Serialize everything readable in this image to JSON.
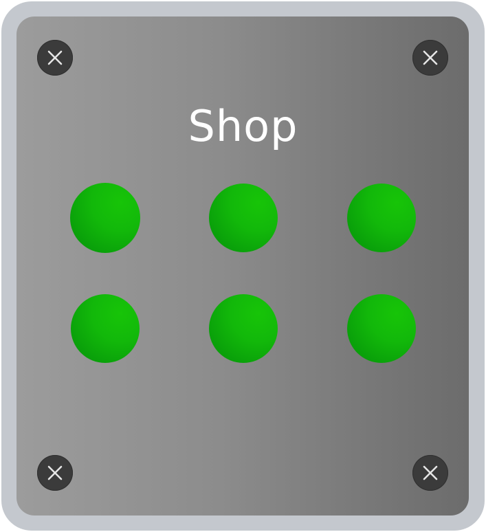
{
  "shop": {
    "title": "Shop",
    "slot_color": "#12b80a",
    "slot_count": 6
  },
  "frame": {
    "border_color": "#c4c8ce",
    "panel_color_left": "#9c9c9c",
    "panel_color_right": "#6c6c6c"
  },
  "icons": {
    "corner": "close-icon"
  }
}
